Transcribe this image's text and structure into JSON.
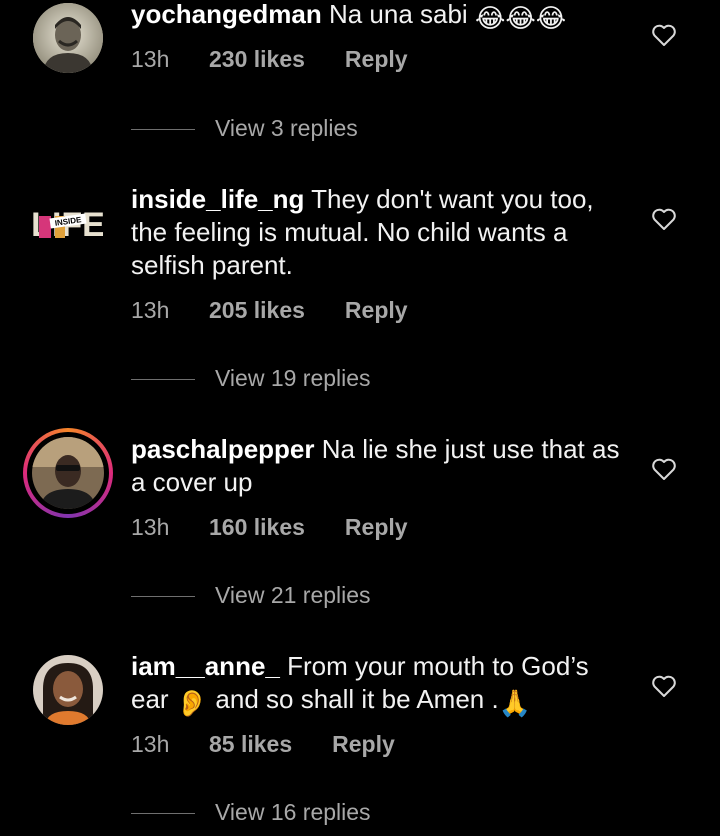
{
  "comments": [
    {
      "username": "yochangedman",
      "text": "Na una sabi",
      "emoji_suffix": "😂😂😂",
      "time": "13h",
      "likes": "230 likes",
      "reply": "Reply",
      "view_replies": "View 3 replies"
    },
    {
      "username": "inside_life_ng",
      "text": "They don't want you too, the feeling is mutual. No child wants a selfish parent.",
      "time": "13h",
      "likes": "205 likes",
      "reply": "Reply",
      "view_replies": "View 19 replies",
      "avatar_text_top": "LIFE",
      "avatar_text_badge": "INSIDE"
    },
    {
      "username": "paschalpepper",
      "text": "Na lie she just use that as a cover up",
      "time": "13h",
      "likes": "160 likes",
      "reply": "Reply",
      "view_replies": "View 21 replies"
    },
    {
      "username": "iam__anne_",
      "text_part1": "From your mouth to God’s ear",
      "emoji_ear": "👂",
      "text_part2": "and so shall it be Amen .",
      "emoji_pray": "🙏",
      "time": "13h",
      "likes": "85 likes",
      "reply": "Reply",
      "view_replies": "View 16 replies"
    }
  ],
  "icons": {
    "like": "heart-outline-icon"
  },
  "colors": {
    "background": "#000000",
    "text": "#f2f2f2",
    "secondary": "#a8a8a8",
    "story_ring": [
      "#f58529",
      "#dd2a7b",
      "#8134af"
    ]
  }
}
